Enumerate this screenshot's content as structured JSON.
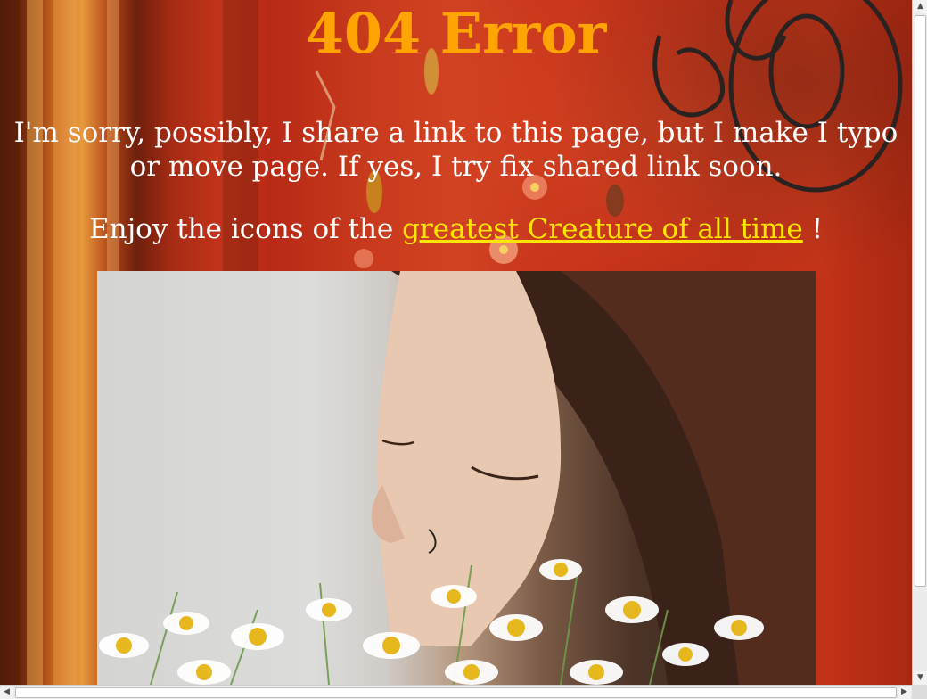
{
  "page": {
    "title": "404 Error",
    "message": "I'm sorry, possibly, I share a link to this page, but I make I typo or move page. If yes, I try fix shared link soon.",
    "enjoy_prefix": "Enjoy the icons of the ",
    "enjoy_link": "greatest Creature of all time",
    "enjoy_suffix": " !"
  },
  "photo": {
    "subject": "woman smelling chamomile flowers"
  },
  "scrollbars": {
    "up_arrow": "▲",
    "down_arrow": "▼",
    "left_arrow": "◀",
    "right_arrow": "▶"
  },
  "colors": {
    "title": "#ffa400",
    "link": "#ffe600",
    "text": "#ffffff",
    "background": "#c8351a"
  }
}
